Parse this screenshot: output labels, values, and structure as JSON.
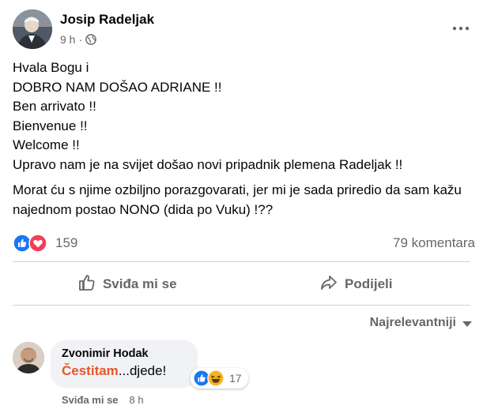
{
  "post": {
    "author": "Josip Radeljak",
    "time": "9 h",
    "privacy_icon": "globe-icon",
    "menu_icon": "more-options-icon",
    "lines": [
      "Hvala Bogu i",
      "DOBRO NAM DOŠAO ADRIANE !!",
      "Ben arrivato !!",
      "Bienvenue !!",
      "Welcome !!",
      "Upravo nam je na svijet došao novi pripadnik plemena Radeljak !!"
    ],
    "paragraph2": "Morat ću s njime ozbiljno porazgovarati, jer mi je sada priredio da sam kažu najednom postao NONO (dida po Vuku) !??"
  },
  "stats": {
    "reaction_icons": [
      "like-reaction-icon",
      "love-reaction-icon"
    ],
    "reaction_count": "159",
    "comment_count": "79 komentara"
  },
  "actions": {
    "like_label": "Sviđa mi se",
    "share_label": "Podijeli"
  },
  "comments_sort": {
    "label": "Najrelevantniji"
  },
  "comment": {
    "author": "Zvonimir Hodak",
    "highlight": "Čestitam",
    "text": "...djede!",
    "reaction_icons": [
      "like-reaction-icon",
      "haha-reaction-icon"
    ],
    "reaction_count": "17",
    "like_link": "Sviđa mi se",
    "time": "8 h"
  },
  "colors": {
    "text_primary": "#050505",
    "text_secondary": "#65676b",
    "like_blue": "#1877f2",
    "love_red": "#f33e58",
    "haha_yellow": "#f7b125",
    "highlight_orange": "#e4572e",
    "bubble_bg": "#f0f2f5",
    "divider": "#ced0d4"
  }
}
